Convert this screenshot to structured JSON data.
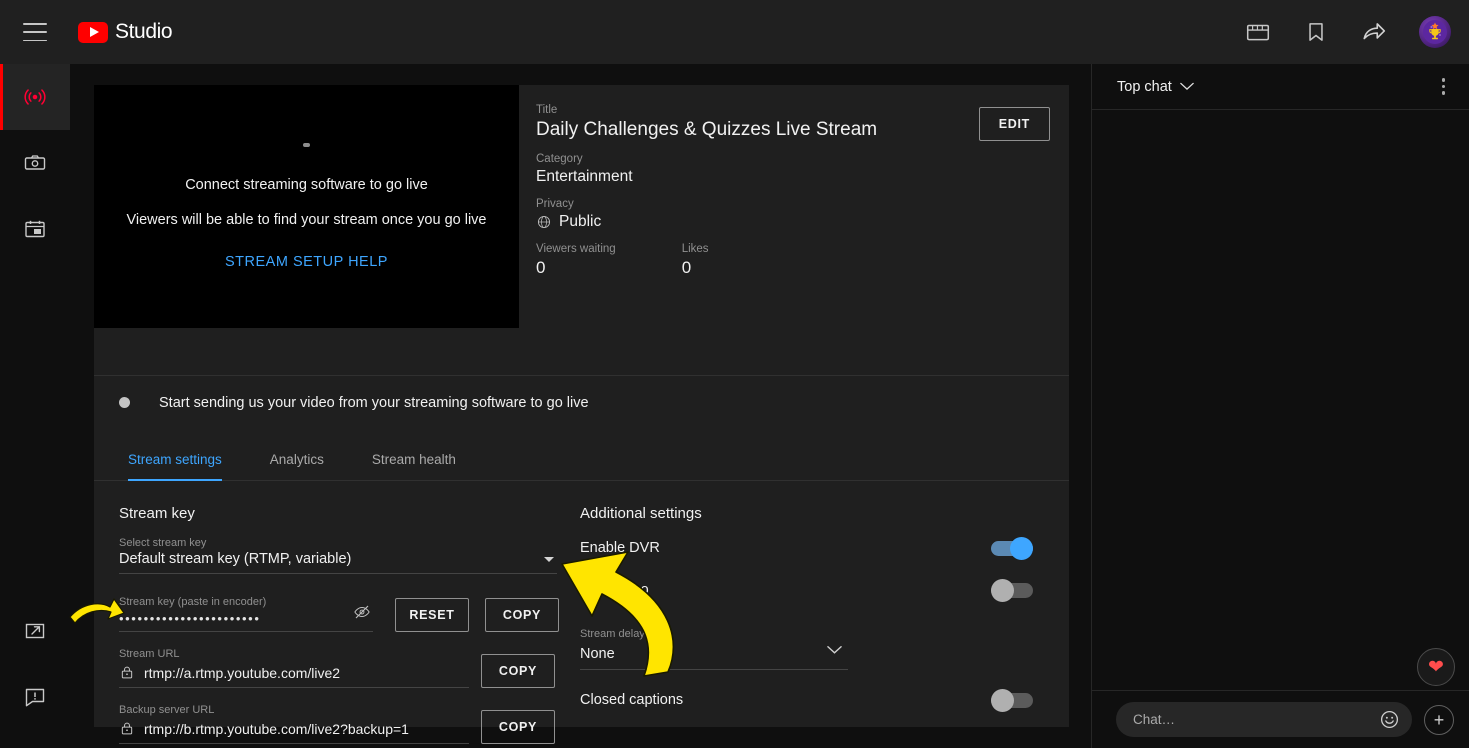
{
  "topbar": {
    "brand": "Studio",
    "icons": [
      {
        "name": "clapperboard-icon"
      },
      {
        "name": "bookmark-icon"
      },
      {
        "name": "share-icon"
      }
    ],
    "avatar_label": "trophy-avatar"
  },
  "rail": {
    "items": [
      {
        "name": "sidebar-item-go-live",
        "icon": "broadcast-icon",
        "active": true
      },
      {
        "name": "sidebar-item-webcam",
        "icon": "camera-icon",
        "active": false
      },
      {
        "name": "sidebar-item-manage",
        "icon": "calendar-icon",
        "active": false
      }
    ],
    "bottom_items": [
      {
        "name": "sidebar-item-open-external",
        "icon": "external-link-icon"
      },
      {
        "name": "sidebar-item-feedback",
        "icon": "feedback-icon"
      }
    ]
  },
  "preview": {
    "line1": "Connect streaming software to go live",
    "line2": "Viewers will be able to find your stream once you go live",
    "help_link": "STREAM SETUP HELP"
  },
  "stream_info": {
    "title_label": "Title",
    "title_value": "Daily Challenges & Quizzes Live Stream",
    "category_label": "Category",
    "category_value": "Entertainment",
    "privacy_label": "Privacy",
    "privacy_value": "Public",
    "viewers_label": "Viewers waiting",
    "viewers_value": "0",
    "likes_label": "Likes",
    "likes_value": "0",
    "edit_button": "EDIT"
  },
  "status": {
    "message": "Start sending us your video from your streaming software to go live"
  },
  "tabs": [
    {
      "label": "Stream settings",
      "active": true
    },
    {
      "label": "Analytics",
      "active": false
    },
    {
      "label": "Stream health",
      "active": false
    }
  ],
  "stream_key": {
    "section_title": "Stream key",
    "select_label": "Select stream key",
    "select_value": "Default stream key (RTMP, variable)",
    "key_label": "Stream key (paste in encoder)",
    "key_masked": "•••••••••••••••••••••••",
    "reset_button": "RESET",
    "copy_button": "COPY",
    "stream_url_label": "Stream URL",
    "stream_url_value": "rtmp://a.rtmp.youtube.com/live2",
    "stream_url_copy": "COPY",
    "backup_url_label": "Backup server URL",
    "backup_url_value": "rtmp://b.rtmp.youtube.com/live2?backup=1",
    "backup_url_copy": "COPY"
  },
  "additional_settings": {
    "section_title": "Additional settings",
    "dvr_label": "Enable DVR",
    "dvr_on": true,
    "video360_label": "360° video",
    "video360_on": false,
    "delay_label": "Stream delay",
    "delay_value": "None",
    "captions_label": "Closed captions",
    "captions_on": false
  },
  "chat": {
    "title": "Top chat",
    "input_placeholder": "Chat…",
    "heart": "❤",
    "plus": "+"
  },
  "colors": {
    "accent_blue": "#3ea6ff",
    "brand_red": "#ff0000",
    "panel_bg": "#1f1f1f",
    "page_bg": "#0f0f0f",
    "annotation_yellow": "#ffe500"
  }
}
